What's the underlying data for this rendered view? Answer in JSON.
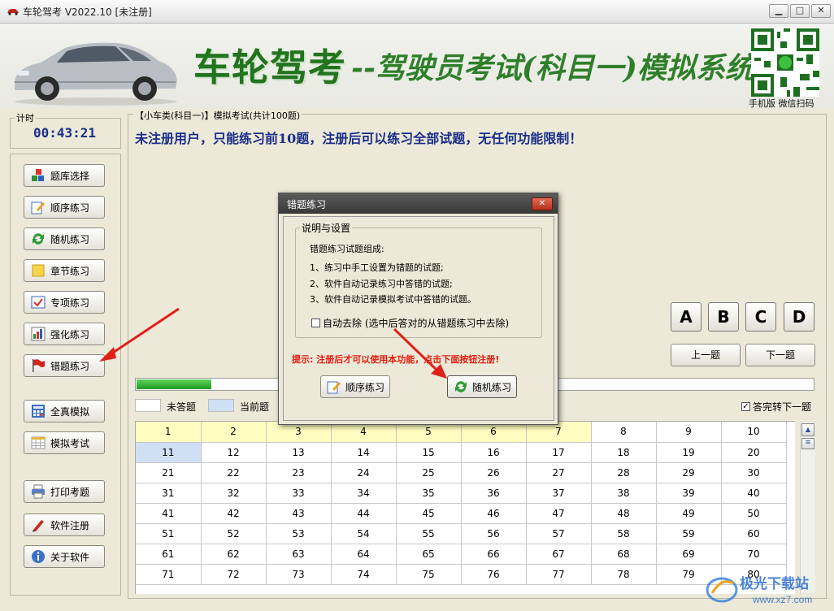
{
  "window": {
    "title": "车轮驾考 V2022.10 [未注册]",
    "minimize": "▁",
    "maximize": "□",
    "close": "✕"
  },
  "banner": {
    "brand": "车轮驾考",
    "subtitle": "--驾驶员考试(科目一)模拟系统",
    "qr_caption": "手机版 微信扫码"
  },
  "timer": {
    "label": "计时",
    "value": "00:43:21"
  },
  "sidebar": {
    "items": [
      {
        "label": "题库选择",
        "icon": "cubes-icon"
      },
      {
        "label": "顺序练习",
        "icon": "edit-icon"
      },
      {
        "label": "随机练习",
        "icon": "refresh-icon"
      },
      {
        "label": "章节练习",
        "icon": "note-icon"
      },
      {
        "label": "专项练习",
        "icon": "checklist-icon"
      },
      {
        "label": "强化练习",
        "icon": "bar-chart-icon"
      },
      {
        "label": "错题练习",
        "icon": "red-flag-icon"
      },
      {
        "label": "全真模拟",
        "icon": "calculator-icon"
      },
      {
        "label": "模拟考试",
        "icon": "table-icon"
      },
      {
        "label": "打印考题",
        "icon": "printer-icon"
      },
      {
        "label": "软件注册",
        "icon": "pen-icon"
      },
      {
        "label": "关于软件",
        "icon": "info-icon"
      }
    ]
  },
  "main": {
    "caption": "【小车类(科目一)】模拟考试(共计100题)",
    "notice": "未注册用户，只能练习前10题，注册后可以练习全部试题，无任何功能限制！",
    "answers": [
      "A",
      "B",
      "C",
      "D"
    ],
    "prev_label": "上一题",
    "next_label": "下一题",
    "progress": 0.11,
    "legend": {
      "unanswered": "未答题",
      "current": "当前题"
    },
    "auto_next": {
      "label": "答完转下一题",
      "checked": true
    },
    "grid_rows": [
      [
        "1",
        "2",
        "3",
        "4",
        "5",
        "6",
        "7",
        "8",
        "9",
        "10"
      ],
      [
        "11",
        "12",
        "13",
        "14",
        "15",
        "16",
        "17",
        "18",
        "19",
        "20"
      ],
      [
        "21",
        "22",
        "23",
        "24",
        "25",
        "26",
        "27",
        "28",
        "29",
        "30"
      ],
      [
        "31",
        "32",
        "33",
        "34",
        "35",
        "36",
        "37",
        "38",
        "39",
        "40"
      ],
      [
        "41",
        "42",
        "43",
        "44",
        "45",
        "46",
        "47",
        "48",
        "49",
        "50"
      ],
      [
        "51",
        "52",
        "53",
        "54",
        "55",
        "56",
        "57",
        "58",
        "59",
        "60"
      ],
      [
        "61",
        "62",
        "63",
        "64",
        "65",
        "66",
        "67",
        "68",
        "69",
        "70"
      ],
      [
        "71",
        "72",
        "73",
        "74",
        "75",
        "76",
        "77",
        "78",
        "79",
        "80"
      ]
    ],
    "answered_count": 7,
    "current_question": "11"
  },
  "dialog": {
    "title": "错题练习",
    "close": "✕",
    "group_title": "说明与设置",
    "lines": [
      "错题练习试题组成:",
      "1、练习中手工设置为错题的试题;",
      "2、软件自动记录练习中答错的试题;",
      "3、软件自动记录模拟考试中答错的试题。"
    ],
    "auto_remove": {
      "label": "自动去除 (选中后答对的从错题练习中去除)",
      "checked": false
    },
    "hint": "提示: 注册后才可以使用本功能，点击下面按钮注册!",
    "btn_sequential": "顺序练习",
    "btn_random": "随机练习"
  },
  "colors": {
    "accent_blue": "#1a2e8a",
    "hint_red": "#e21b0c",
    "brand_green": "#22741f",
    "answered_yellow": "#fffdc0",
    "current_blue": "#cfe0f5"
  }
}
